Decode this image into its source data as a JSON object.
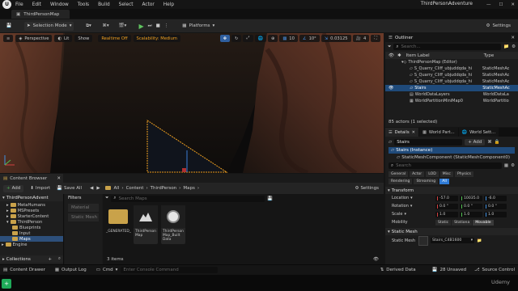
{
  "menubar": {
    "items": [
      "File",
      "Edit",
      "Window",
      "Tools",
      "Build",
      "Select",
      "Actor",
      "Help"
    ],
    "project_title": "ThirdPersonAdventure"
  },
  "map_tab": {
    "label": "ThirdPersonMap"
  },
  "toolbar": {
    "mode_label": "Selection Mode",
    "platforms_label": "Platforms",
    "settings_label": "Settings"
  },
  "viewport": {
    "perspective_label": "Perspective",
    "lit_label": "Lit",
    "show_label": "Show",
    "realtime_badge": "Realtime Off",
    "scalability_label": "Scalability: Medium",
    "grid_value": "10",
    "rot_value": "10°",
    "scale_value": "0.03125",
    "cam_speed": "4"
  },
  "outliner": {
    "tab_label": "Outliner",
    "search_placeholder": "Search...",
    "col_item": "Item Label",
    "col_type": "Type",
    "rows": [
      {
        "label": "ThirdPersonMap (Editor)",
        "type": ""
      },
      {
        "label": "S_Quarry_Cliff_ubjuddqda_hi",
        "type": "StaticMeshAc"
      },
      {
        "label": "S_Quarry_Cliff_ubjuddqda_hi",
        "type": "StaticMeshAc"
      },
      {
        "label": "S_Quarry_Cliff_ubjuddqda_hi",
        "type": "StaticMeshAc"
      },
      {
        "label": "Stairs",
        "type": "StaticMeshAc"
      },
      {
        "label": "WorldDataLayers",
        "type": "WorldDataLa"
      },
      {
        "label": "WorldPartitionMiniMap0",
        "type": "WorldPartitio"
      }
    ],
    "count_label": "85 actors (1 selected)"
  },
  "details": {
    "tabs": [
      "Details",
      "World Part...",
      "World Sett..."
    ],
    "actor_name": "Stairs",
    "add_label": "+ Add",
    "instance_label": "Stairs (Instance)",
    "component_label": "StaticMeshComponent (StaticMeshComponent0)",
    "search_placeholder": "Search",
    "filter_row1": [
      "General",
      "Actor",
      "LOD",
      "Misc",
      "Physics"
    ],
    "filter_row2": [
      "Rendering",
      "Streaming",
      "All"
    ],
    "section_transform": "Transform",
    "location_label": "Location",
    "location": [
      "-57.0",
      "10035.0",
      "-6.0"
    ],
    "rotation_label": "Rotation",
    "rotation": [
      "0.0 °",
      "0.0 °",
      "0.0 °"
    ],
    "scale_label": "Scale",
    "scale": [
      "1.0",
      "1.0",
      "1.0"
    ],
    "mobility_label": "Mobility",
    "mobility_options": [
      "Static",
      "Stationa",
      "Movable"
    ],
    "section_static_mesh": "Static Mesh",
    "static_mesh_label": "Static Mesh",
    "static_mesh_value": "Stairs_C4B1600"
  },
  "content_browser": {
    "tab_label": "Content Browser",
    "add_label": "Add",
    "import_label": "Import",
    "save_all_label": "Save All",
    "breadcrumb": [
      "All",
      "Content",
      "ThirdPerson",
      "Maps"
    ],
    "settings_label": "Settings",
    "project_root": "ThirdPersonAdvent",
    "tree": [
      "MetaHumans",
      "MSPresets",
      "StarterContent",
      "ThirdPerson",
      "Blueprints",
      "Input",
      "Maps",
      "Engine"
    ],
    "collections_label": "Collections",
    "filters_label": "Filters",
    "filter_items": [
      "Material",
      "Static Mesh"
    ],
    "search_placeholder": "Search Maps",
    "assets": [
      {
        "name": "_GENERATED_",
        "kind": "folder"
      },
      {
        "name": "ThirdPerson Map",
        "kind": "map"
      },
      {
        "name": "ThirdPerson Map_Built Data",
        "kind": "data"
      }
    ],
    "item_count": "3 items"
  },
  "statusbar": {
    "content_drawer": "Content Drawer",
    "output_log": "Output Log",
    "cmd_label": "Cmd",
    "console_placeholder": "Enter Console Command",
    "derived_data": "Derived Data",
    "unsaved": "28 Unsaved",
    "source_control": "Source Control"
  },
  "watermark": "Udemy",
  "colors": {
    "accent": "#2f7bd6",
    "selection": "#1f4a7a",
    "add_green": "#4caf50",
    "orange": "#f0a020"
  }
}
